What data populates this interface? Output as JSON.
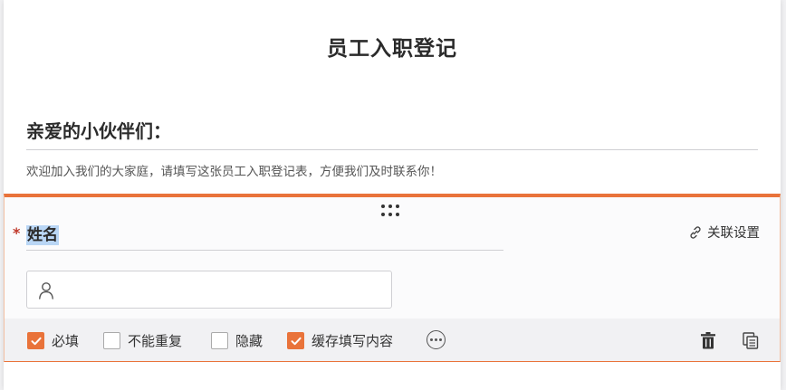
{
  "form": {
    "title": "员工入职登记",
    "intro_heading": "亲爱的小伙伴们：",
    "intro_text": "欢迎加入我们的大家庭，请填写这张员工入职登记表，方便我们及时联系你！"
  },
  "field": {
    "required_mark": "*",
    "label": "姓名",
    "link_settings_label": "关联设置",
    "input_icon": "user-icon",
    "options": [
      {
        "label": "必填",
        "checked": true
      },
      {
        "label": "不能重复",
        "checked": false
      },
      {
        "label": "隐藏",
        "checked": false
      },
      {
        "label": "缓存填写内容",
        "checked": true
      }
    ]
  },
  "colors": {
    "accent": "#e9733a",
    "selection": "#b9d6f5"
  },
  "icons": [
    "drag-handle-icon",
    "link-icon",
    "user-icon",
    "more-icon",
    "trash-icon",
    "copy-icon",
    "checkmark-icon"
  ]
}
